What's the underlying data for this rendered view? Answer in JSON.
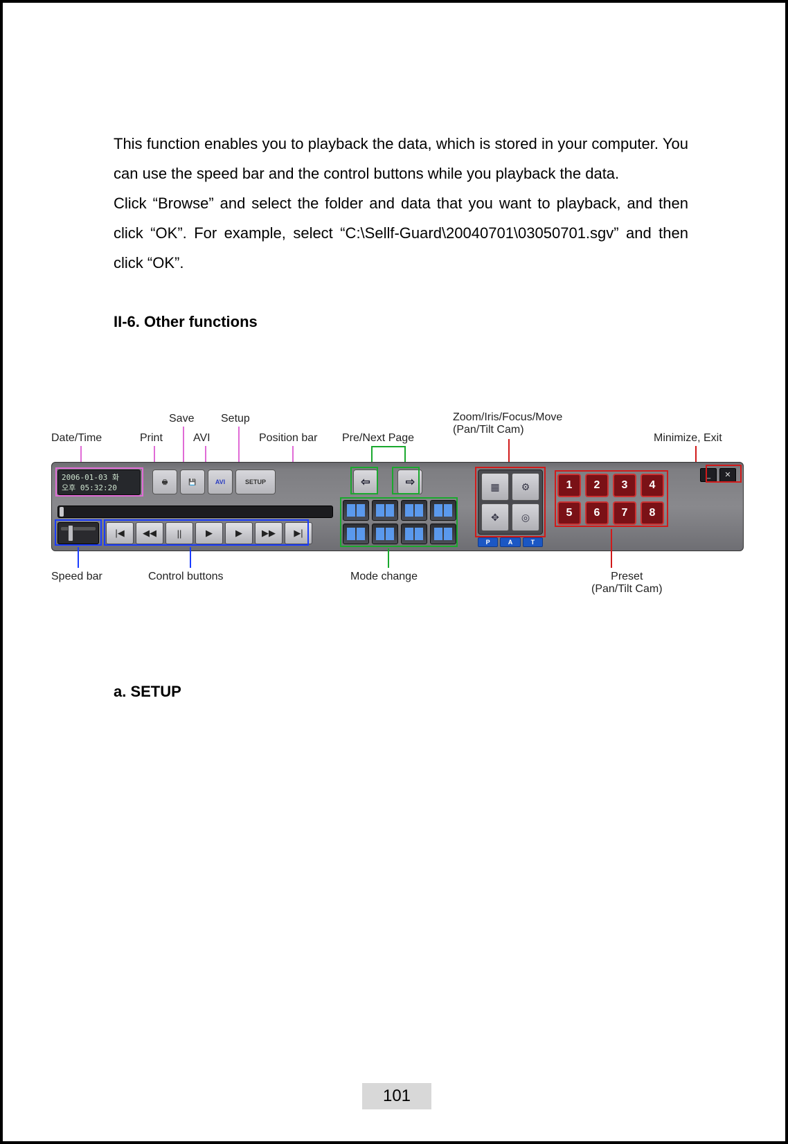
{
  "paragraph": "This function enables you to playback the data, which is stored in your computer. You can use the speed bar and the control buttons while you playback the data.\nClick “Browse” and select the folder and data that you want to playback, and then click “OK”. For example, select “C:\\Sellf-Guard\\20040701\\03050701.sgv” and then click “OK”.",
  "heading_other_functions": "II-6. Other functions",
  "heading_setup": "a. SETUP",
  "page_number": "101",
  "labels": {
    "date_time": "Date/Time",
    "print": "Print",
    "save": "Save",
    "avi": "AVI",
    "setup": "Setup",
    "position_bar": "Position bar",
    "pre_next": "Pre/Next Page",
    "zoom_iris": "Zoom/Iris/Focus/Move\n(Pan/Tilt Cam)",
    "minimize_exit": "Minimize, Exit",
    "speed_bar": "Speed bar",
    "control_buttons": "Control buttons",
    "mode_change": "Mode change",
    "preset": "Preset\n(Pan/Tilt Cam)"
  },
  "toolbar": {
    "date_line1": "2006-01-03 화",
    "date_line2": "오후 05:32:20",
    "mini": {
      "print": "🖶",
      "save": "💾",
      "avi": "AVI",
      "setup": "SETUP"
    },
    "controls": [
      "|◀",
      "◀◀",
      "||",
      "▶",
      "▶",
      "▶▶",
      "▶|"
    ],
    "arrows": {
      "prev": "⇦",
      "next": "⇨"
    },
    "ptz_icons": [
      "▦",
      "⚙",
      "✥",
      "◎"
    ],
    "ptz_bar": [
      "P",
      "A",
      "T"
    ],
    "presets": [
      "1",
      "2",
      "3",
      "4",
      "5",
      "6",
      "7",
      "8"
    ],
    "win": {
      "min": "_",
      "close": "✕"
    }
  }
}
